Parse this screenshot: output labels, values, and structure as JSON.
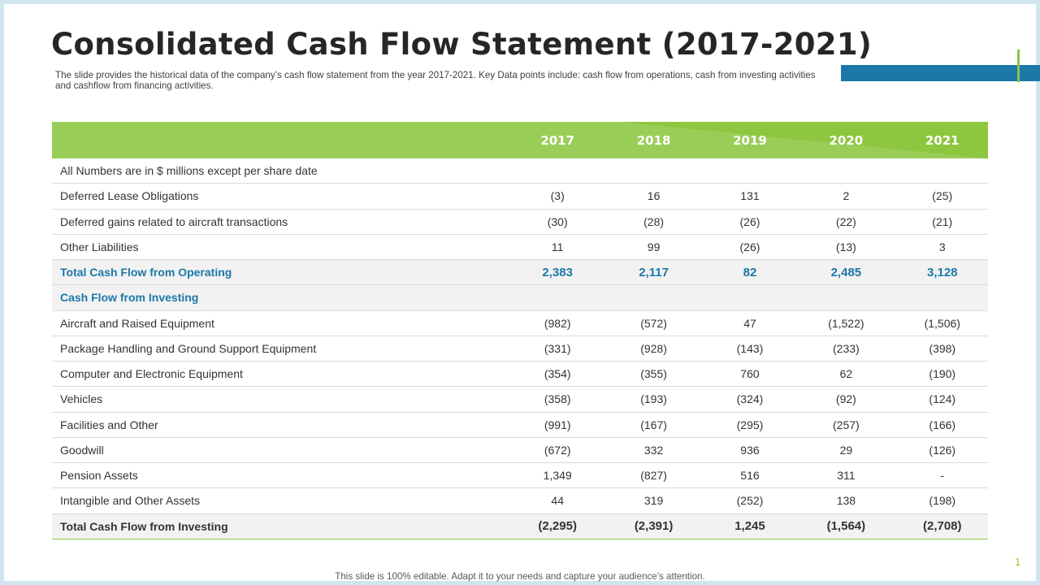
{
  "slide": {
    "title": "Consolidated Cash Flow Statement (2017-2021)",
    "subtitle": "The slide provides the historical data of the company’s cash flow statement from the year 2017-2021. Key Data points include: cash flow from operations, cash from investing activities and cashflow from financing activities.",
    "footer": "This slide is 100% editable. Adapt it to your needs and capture your audience’s attention.",
    "page_number": "1"
  },
  "colors": {
    "header_green": "#8dc63f",
    "accent_blue": "#1b78a8",
    "title_text": "#262626"
  },
  "table": {
    "columns": [
      "2017",
      "2018",
      "2019",
      "2020",
      "2021"
    ],
    "rows": [
      {
        "label": "All Numbers are in $ millions except per share date",
        "values": [
          "",
          "",
          "",
          "",
          ""
        ],
        "style": "plain"
      },
      {
        "label": "Deferred Lease Obligations",
        "values": [
          "(3)",
          "16",
          "131",
          "2",
          "(25)"
        ],
        "style": "plain"
      },
      {
        "label": "Deferred gains related to aircraft transactions",
        "values": [
          "(30)",
          "(28)",
          "(26)",
          "(22)",
          "(21)"
        ],
        "style": "plain"
      },
      {
        "label": "Other Liabilities",
        "values": [
          "11",
          "99",
          "(26)",
          "(13)",
          "3"
        ],
        "style": "plain"
      },
      {
        "label": "Total  Cash Flow from Operating",
        "values": [
          "2,383",
          "2,117",
          "82",
          "2,485",
          "3,128"
        ],
        "style": "blue"
      },
      {
        "label": "Cash Flow from Investing",
        "values": [
          "",
          "",
          "",
          "",
          ""
        ],
        "style": "blue-section"
      },
      {
        "label": "Aircraft and Raised Equipment",
        "values": [
          "(982)",
          "(572)",
          "47",
          "(1,522)",
          "(1,506)"
        ],
        "style": "plain"
      },
      {
        "label": "Package Handling  and Ground Support Equipment",
        "values": [
          "(331)",
          "(928)",
          "(143)",
          "(233)",
          "(398)"
        ],
        "style": "plain"
      },
      {
        "label": "Computer and Electronic Equipment",
        "values": [
          "(354)",
          "(355)",
          "760",
          "62",
          "(190)"
        ],
        "style": "plain"
      },
      {
        "label": "Vehicles",
        "values": [
          "(358)",
          "(193)",
          "(324)",
          "(92)",
          "(124)"
        ],
        "style": "plain"
      },
      {
        "label": "Facilities and Other",
        "values": [
          "(991)",
          "(167)",
          "(295)",
          "(257)",
          "(166)"
        ],
        "style": "plain"
      },
      {
        "label": "Goodwill",
        "values": [
          "(672)",
          "332",
          "936",
          "29",
          "(126)"
        ],
        "style": "plain"
      },
      {
        "label": "Pension Assets",
        "values": [
          "1,349",
          "(827)",
          "516",
          "311",
          "-"
        ],
        "style": "plain"
      },
      {
        "label": "Intangible and Other Assets",
        "values": [
          "44",
          "319",
          "(252)",
          "138",
          "(198)"
        ],
        "style": "plain"
      },
      {
        "label": "Total Cash Flow from Investing",
        "values": [
          "(2,295)",
          "(2,391)",
          "1,245",
          "(1,564)",
          "(2,708)"
        ],
        "style": "bold-total"
      }
    ]
  }
}
